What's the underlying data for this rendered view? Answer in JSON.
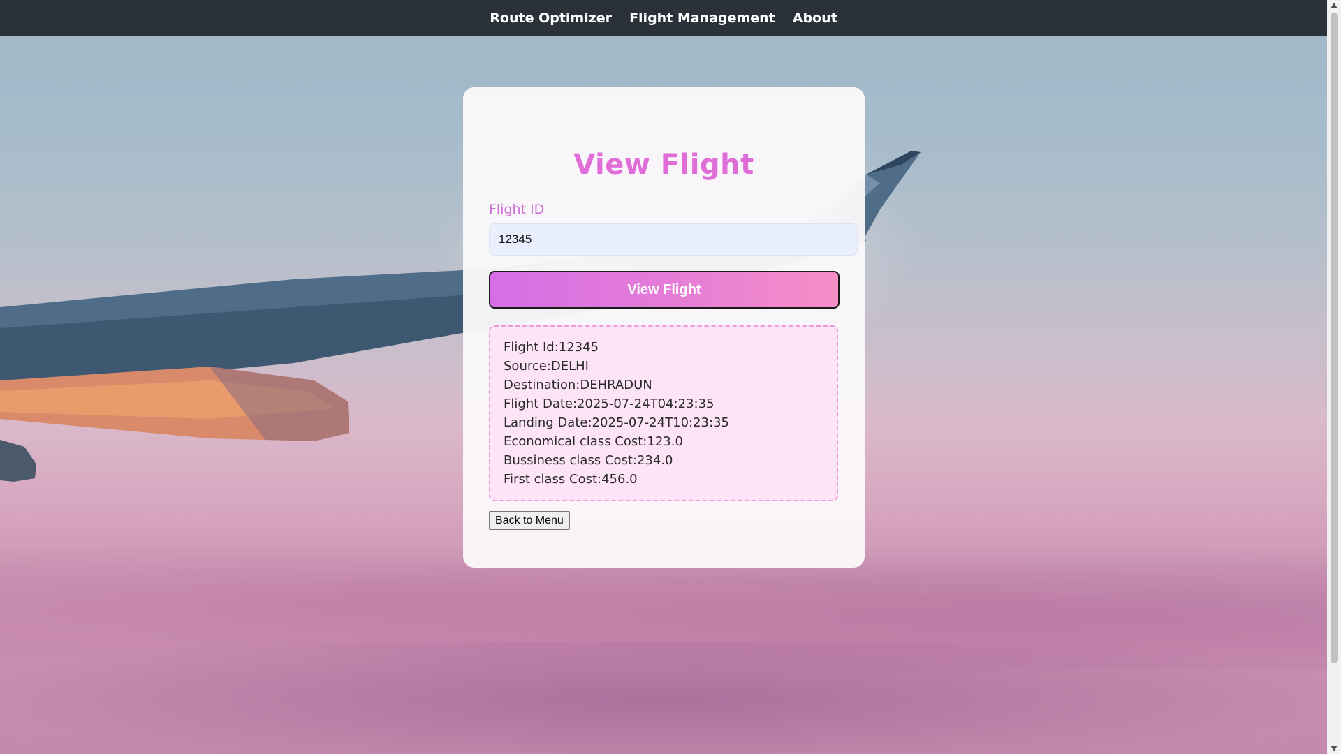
{
  "nav": {
    "items": [
      {
        "label": "Route Optimizer"
      },
      {
        "label": "Flight Management"
      },
      {
        "label": "About"
      }
    ]
  },
  "card": {
    "title": "View Flight",
    "flight_id_label": "Flight ID",
    "flight_id_value": "12345",
    "submit_label": "View Flight",
    "result": {
      "lines": [
        "Flight Id:12345",
        "Source:DELHI",
        "Destination:DEHRADUN",
        "Flight Date:2025-07-24T04:23:35",
        "Landing Date:2025-07-24T10:23:35",
        "Economical class Cost:123.0",
        "Bussiness class Cost:234.0",
        "First class Cost:456.0"
      ]
    },
    "back_label": "Back to Menu"
  },
  "colors": {
    "navbar_bg": "#2b3138",
    "title": "#e06ed8",
    "button_gradient_start": "#d56ee6",
    "button_gradient_end": "#f58ec6",
    "result_bg": "#fde4f6",
    "result_border": "#ef9ad8"
  }
}
